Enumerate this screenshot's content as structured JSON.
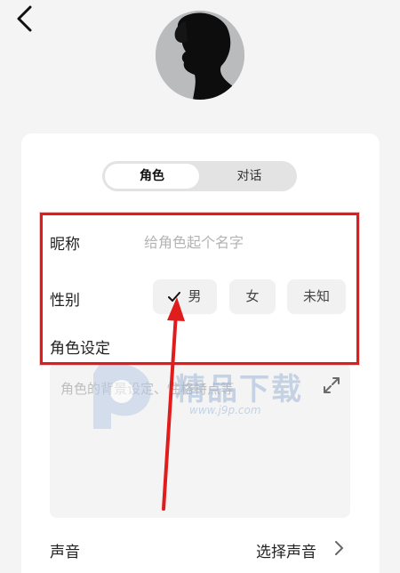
{
  "header": {
    "back_icon": "chevron-left-icon",
    "avatar_icon": "silhouette-avatar"
  },
  "tabs": [
    {
      "label": "角色",
      "active": true
    },
    {
      "label": "对话",
      "active": false
    }
  ],
  "form": {
    "nickname_label": "昵称",
    "nickname_placeholder": "给角色起个名字",
    "nickname_value": "",
    "gender_label": "性别",
    "gender_options": [
      {
        "label": "男",
        "selected": true
      },
      {
        "label": "女",
        "selected": false
      },
      {
        "label": "未知",
        "selected": false
      }
    ],
    "setting_label": "角色设定",
    "setting_placeholder": "角色的背景设定、性格特点等",
    "setting_expand_icon": "expand-icon",
    "voice_label": "声音",
    "voice_value": "选择声音",
    "voice_chevron_icon": "chevron-right-icon"
  },
  "annotation": {
    "color": "#e11c1c"
  },
  "watermark": {
    "brand": "精品下载",
    "url": "www.j9p.com"
  },
  "colors": {
    "background": "#f4f4f4",
    "card": "#ffffff",
    "segment_track": "#e3e3e3",
    "chip": "#f1f1f1",
    "placeholder": "#b3b3b3"
  }
}
